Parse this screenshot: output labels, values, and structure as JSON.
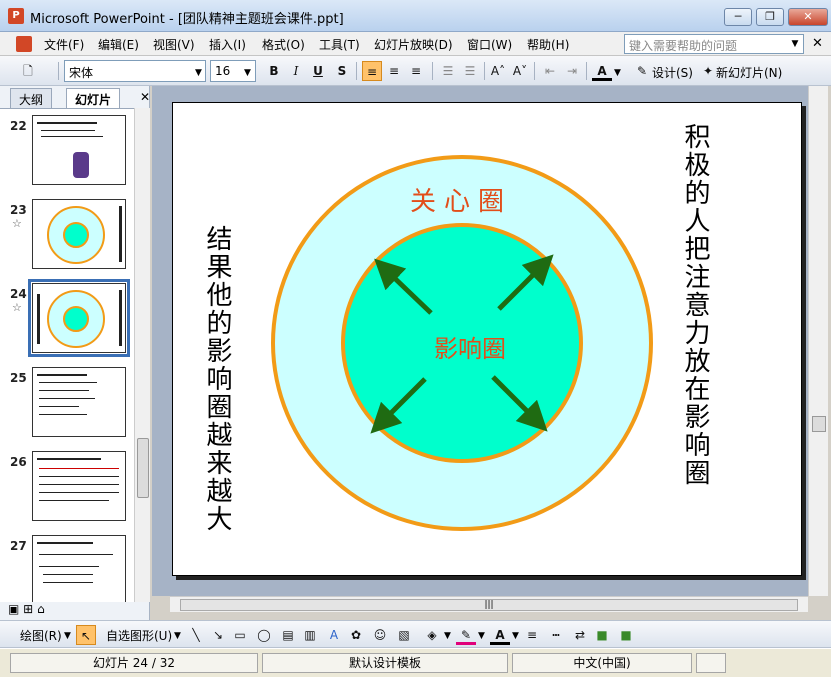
{
  "window": {
    "title": "Microsoft PowerPoint - [团队精神主题班会课件.ppt]",
    "app_icon": "powerpoint-icon",
    "minimize": "─",
    "restore": "❐",
    "close": "✕"
  },
  "menu": {
    "items": [
      "文件(F)",
      "编辑(E)",
      "视图(V)",
      "插入(I)",
      "格式(O)",
      "工具(T)",
      "幻灯片放映(D)",
      "窗口(W)",
      "帮助(H)"
    ],
    "help_placeholder": "键入需要帮助的问题",
    "close_glyph": "✕"
  },
  "toolbar": {
    "font_name": "宋体",
    "font_size": "16",
    "bold": "B",
    "italic": "I",
    "underline": "U",
    "shadow": "S",
    "design_label": "设计(S)",
    "new_slide_label": "新幻灯片(N)"
  },
  "left_panel": {
    "tab_outline": "大纲",
    "tab_slides": "幻灯片",
    "close_glyph": "✕",
    "slides": [
      {
        "number": "22",
        "has_star": false
      },
      {
        "number": "23",
        "has_star": true
      },
      {
        "number": "24",
        "has_star": true,
        "selected": true
      },
      {
        "number": "25",
        "has_star": false
      },
      {
        "number": "26",
        "has_star": false
      },
      {
        "number": "27",
        "has_star": false
      }
    ],
    "star_glyph": "☆"
  },
  "slide": {
    "outer_label": "关心圈",
    "inner_label": "影响圈",
    "left_text": "结果他的影响圈越来越大",
    "right_text": "积极的人把注意力放在影响圈",
    "colors": {
      "outer_fill": "#ccffff",
      "inner_fill": "#00ffcc",
      "ring": "#f29b17",
      "label": "#e24e1a",
      "arrow": "#1f6b12"
    }
  },
  "drawbar": {
    "draw_label": "绘图(R)",
    "autoshape_label": "自选图形(U)"
  },
  "status": {
    "slide_info": "幻灯片 24 / 32",
    "template": "默认设计模板",
    "language": "中文(中国)"
  }
}
